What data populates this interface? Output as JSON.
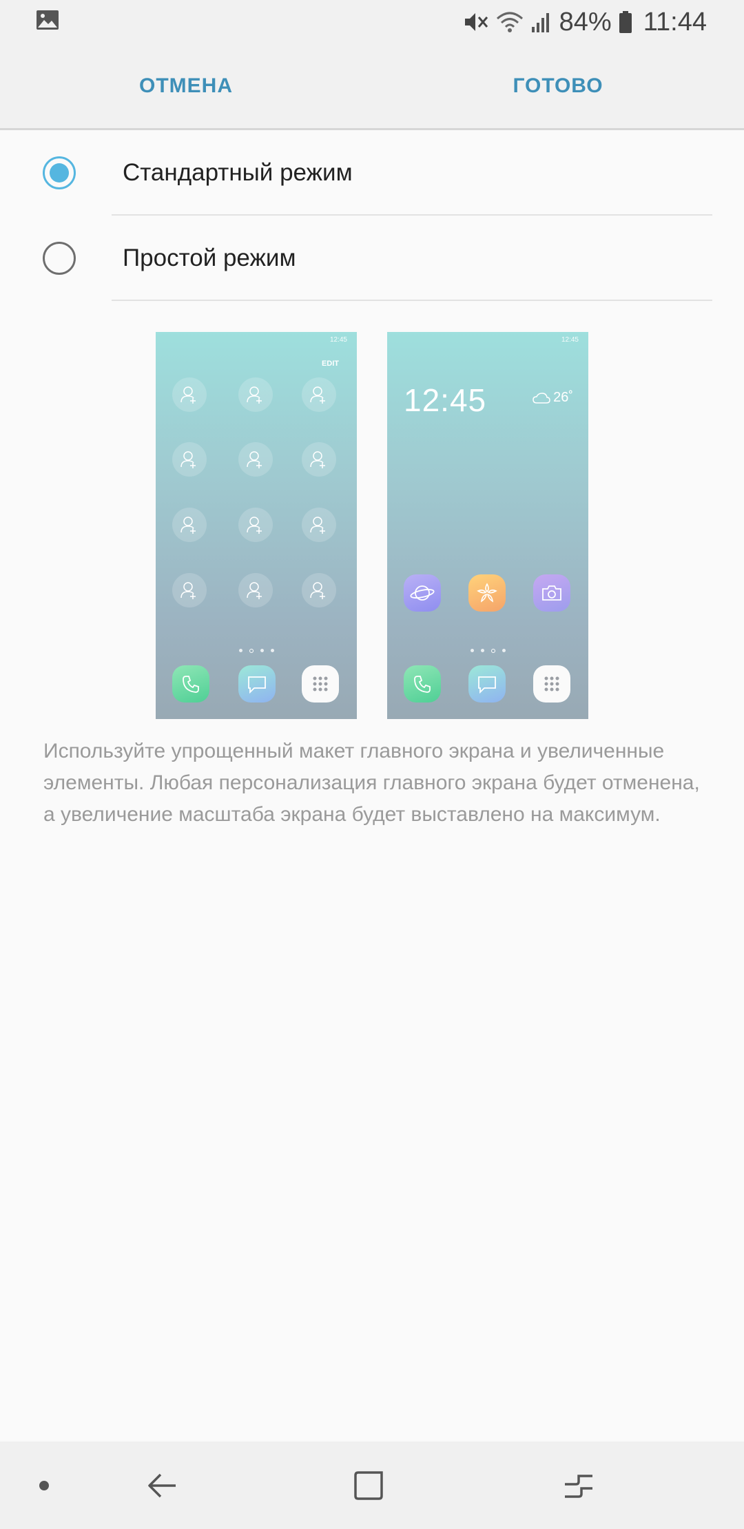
{
  "status_bar": {
    "left_icon": "gallery-notification-icon",
    "icons": [
      "mute-icon",
      "wifi-icon",
      "signal-icon",
      "battery-icon"
    ],
    "battery": "84%",
    "time": "11:44"
  },
  "action_bar": {
    "cancel_label": "ОТМЕНА",
    "done_label": "ГОТОВО",
    "accent_color": "#3e8fb8"
  },
  "options": [
    {
      "label": "Стандартный режим",
      "selected": true
    },
    {
      "label": "Простой режим",
      "selected": false
    }
  ],
  "previews": {
    "standard": {
      "status_time": "12:45",
      "edit_label": "EDIT"
    },
    "easy": {
      "status_time": "12:45",
      "clock": "12:45",
      "temperature": "26˚"
    }
  },
  "description": "Используйте упрощенный макет главного экрана и увеличенные элементы. Любая персонализация главного экрана будет отменена, а увеличение масштаба экрана будет выставлено на максимум.",
  "nav_bar": {
    "icons": [
      "dot-icon",
      "back-icon",
      "home-icon",
      "recents-icon"
    ]
  }
}
